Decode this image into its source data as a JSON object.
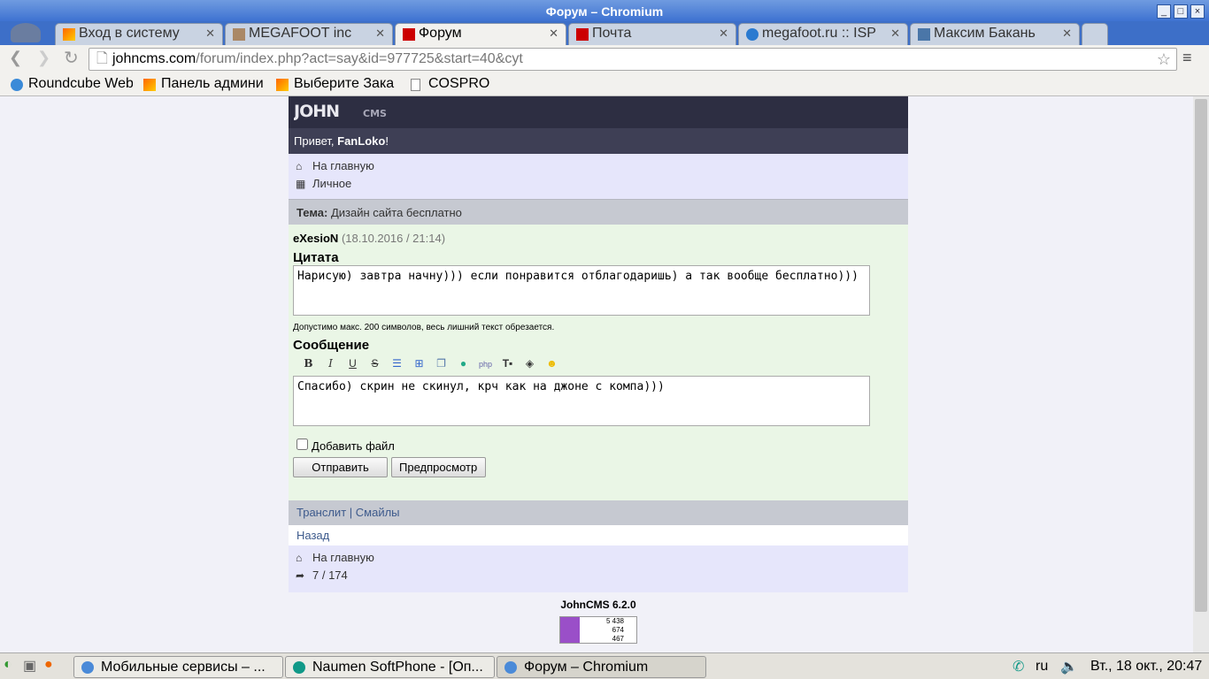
{
  "window": {
    "title": "Форум – Chromium"
  },
  "tabs": [
    {
      "label": "Вход в систему",
      "active": false
    },
    {
      "label": "MEGAFOOT inc",
      "active": false
    },
    {
      "label": "Форум",
      "active": true
    },
    {
      "label": "Почта",
      "active": false
    },
    {
      "label": "megafoot.ru :: ISPmanager",
      "active": false
    },
    {
      "label": "Максим Бакань",
      "active": false
    }
  ],
  "address": {
    "domain": "johncms.com",
    "path": "/forum/index.php?act=say&id=977725&start=40&cyt"
  },
  "bookmarks": [
    "Roundcube Webmail",
    "Панель админи",
    "Выберите Зака",
    "COSPRO"
  ],
  "site": {
    "logo_text": "JOHN CMS",
    "greeting_prefix": "Привет, ",
    "user": "FanLoko",
    "greeting_suffix": "!",
    "nav": [
      {
        "icon": "home-icon",
        "label": "На главную"
      },
      {
        "icon": "grid-icon",
        "label": "Личное"
      }
    ],
    "topic_label": "Тема:",
    "topic": "Дизайн сайта бесплатно",
    "author": "eXesioN",
    "post_date": "(18.10.2016 / 21:14)",
    "quote_label": "Цитата",
    "quote_text": "Нарисую) завтра начну))) если понравится отблагодаришь) а так вообще бесплатно)))",
    "quote_hint": "Допустимо макс. 200 символов, весь лишний текст обрезается.",
    "message_label": "Сообщение",
    "toolbar": [
      "B",
      "I",
      "U",
      "S",
      "list",
      "+",
      "copy",
      "url",
      "php",
      "color",
      "bg",
      "smile"
    ],
    "message_text": "Спасибо) скрин не скинул, крч как на джоне с компа)))",
    "attach_label": "Добавить файл",
    "send_label": "Отправить",
    "preview_label": "Предпросмотр",
    "translit": "Транслит",
    "smiles": "Смайлы",
    "sep": " | ",
    "back": "Назад",
    "bottom_nav": [
      {
        "icon": "home-icon",
        "label": "На главную"
      },
      {
        "icon": "share-icon",
        "label": "7 / 174"
      }
    ],
    "footer": "JohnCMS 6.2.0",
    "counter": [
      "5 438",
      "674",
      "467"
    ]
  },
  "taskbar": {
    "tasks": [
      "Мобильные сервисы – ...",
      "Naumen SoftPhone - [Оп...",
      "Форум – Chromium"
    ],
    "lang": "ru",
    "clock": "Вт., 18 окт., 20:47"
  }
}
